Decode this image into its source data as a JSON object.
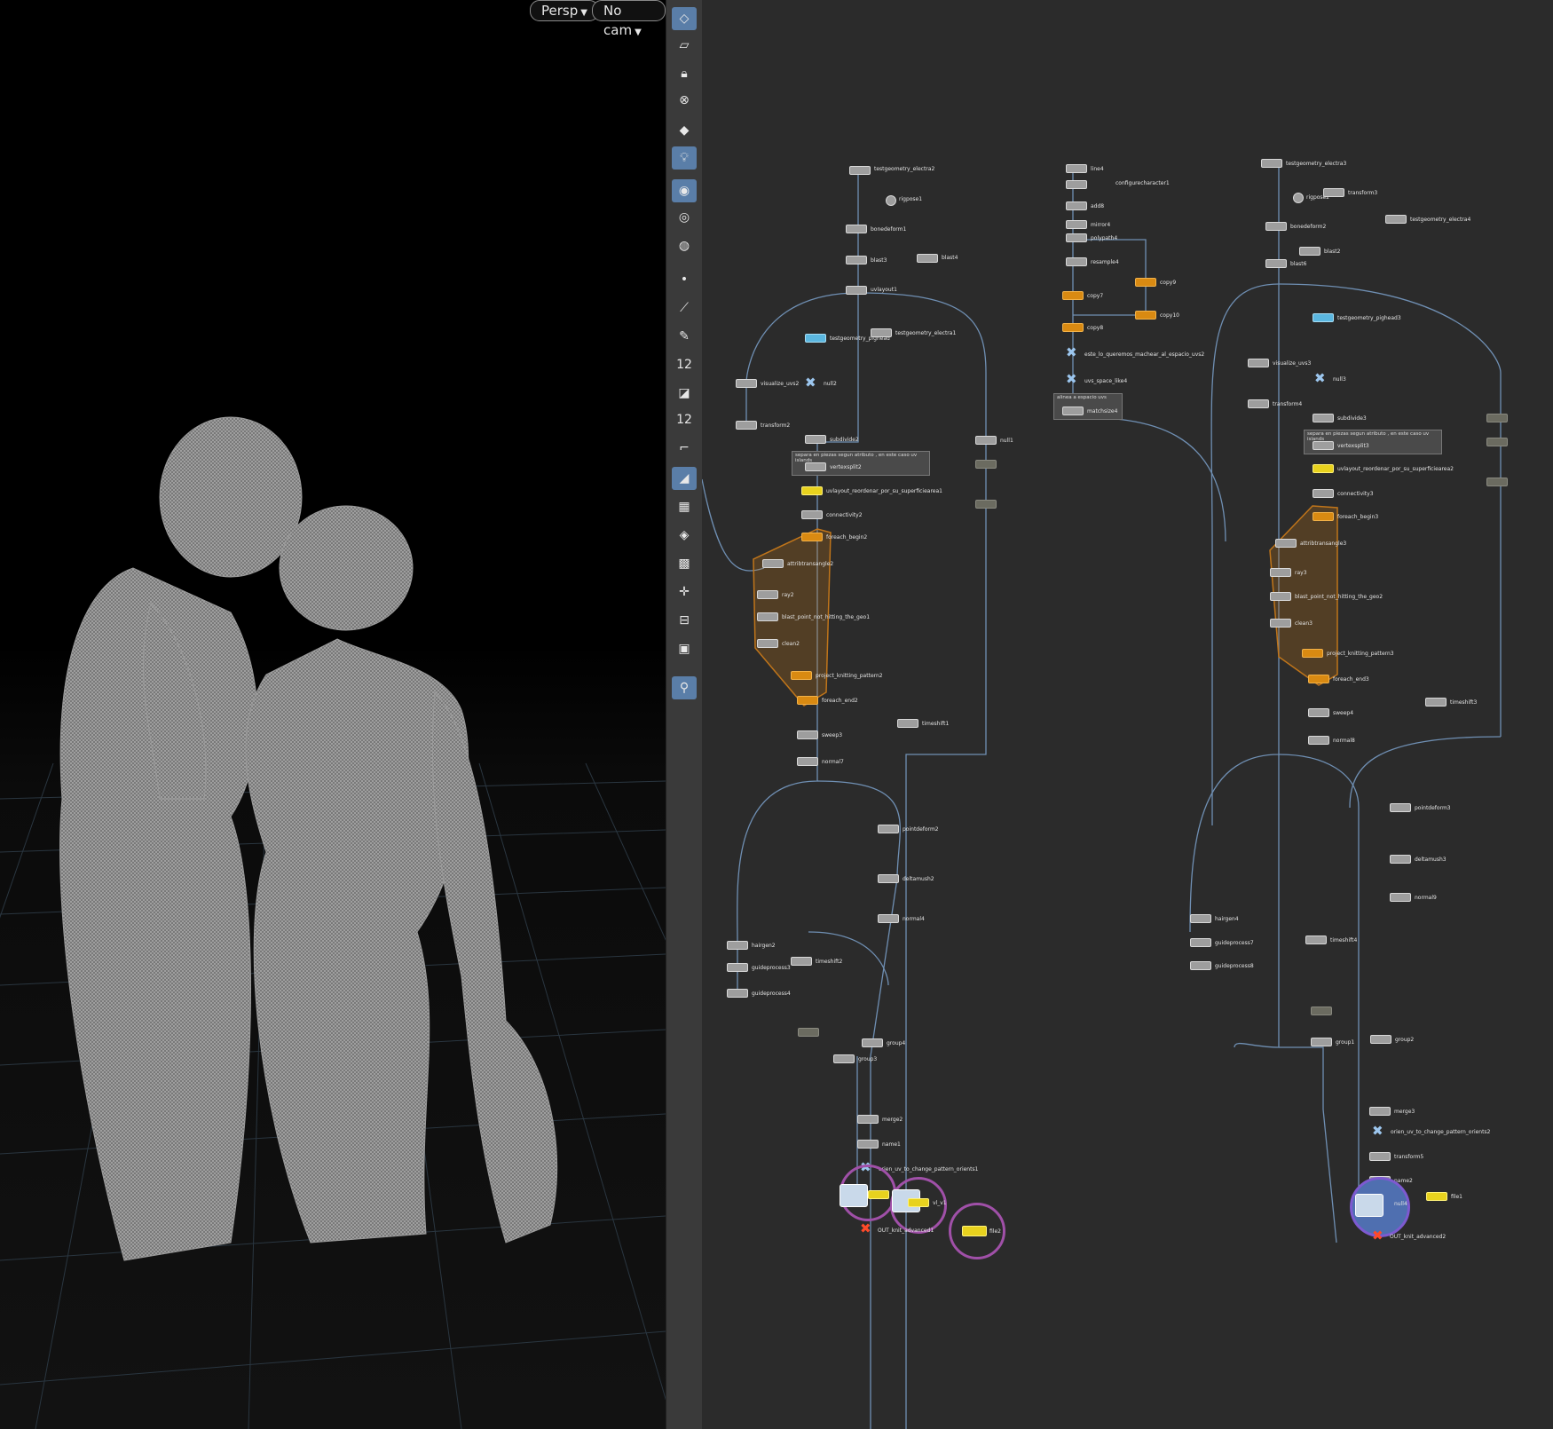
{
  "viewport": {
    "persp_label": "Persp",
    "cam_label": "No cam"
  },
  "toolbar": {
    "icons": [
      "select-icon",
      "edit-icon",
      "lock-icon",
      "ghost-icon",
      "light-diamond-icon",
      "bulb-icon",
      "display-mode-icon",
      "wire-eye-icon",
      "render-eye-icon",
      "point-icon",
      "brush-icon",
      "pen-icon",
      "point-count-icon",
      "surface-icon",
      "surface-count-icon",
      "curve-icon",
      "shaded-icon",
      "checker-icon",
      "frame-icon",
      "uv-icon",
      "axis-icon",
      "panel-icon",
      "landscape-icon",
      "pin-icon"
    ],
    "point_count": "12",
    "surface_count": "12"
  },
  "network": {
    "nodes": {
      "testgeometry_electra2": "testgeometry_electra2",
      "rigpose1": "rigpose1",
      "bonedeform1": "bonedeform1",
      "blast3": "blast3",
      "blast4": "blast4",
      "uvlayout1": "uvlayout1",
      "testgeometry_pighead": "testgeometry_pighead",
      "testgeometry_electra1": "testgeometry_electra1",
      "visualize_uvs2": "visualize_uvs2",
      "null2": "null2",
      "transform2": "transform2",
      "subdivide2": "subdivide2",
      "sticky1": "separa en piezas segun atributo , en este caso uv islands",
      "vertexsplit2": "vertexsplit2",
      "uvlayout_reordenar": "uvlayout_reordenar_por_su_superficiearea1",
      "connectivity2": "connectivity2",
      "foreach_begin2": "foreach_begin2",
      "attribtransangle2": "attribtransangle2",
      "ray2": "ray2",
      "blast_point2": "blast_point_not_hitting_the_geo1",
      "clean2": "clean2",
      "project_knitting_pattern2": "project_knitting_pattern2",
      "foreach_end2": "foreach_end2",
      "sweep3": "sweep3",
      "normal7": "normal7",
      "pointdeform2": "pointdeform2",
      "deltamush2": "deltamush2",
      "normal4": "normal4",
      "hairgen2": "hairgen2",
      "timeshift2": "timeshift2",
      "guideprocess3": "guideprocess3",
      "guideprocess4": "guideprocess4",
      "group4": "group4",
      "group3": "group3",
      "merge2": "merge2",
      "name1": "name1",
      "orien_uv1": "orien_uv_to_change_pattern_orients1",
      "vl": "vl",
      "vl_v1": "vl_v1",
      "out_knit1": "OUT_knit_advanced1",
      "file2": "file2",
      "timeshift1": "timeshift1",
      "null1": "null1",
      "line4": "line4",
      "configurecharacter1": "configurecharacter1",
      "add8": "add8",
      "mirror4": "mirror4",
      "polypath4": "polypath4",
      "resample4": "resample4",
      "copy7": "copy7",
      "copy9": "copy9",
      "copy8": "copy8",
      "copy10": "copy10",
      "este_lo": "este_lo_queremos_machear_al_espacio_uvs2",
      "uvs_space": "uvs_space_like4",
      "sticky2": "alinea a espacio uvs",
      "matchsize4": "matchsize4",
      "testgeometry_electra3": "testgeometry_electra3",
      "rigpose2": "rigpose2",
      "transform3": "transform3",
      "testgeometry_electra4": "testgeometry_electra4",
      "bonedeform2": "bonedeform2",
      "blast2": "blast2",
      "blast6": "blast6",
      "testgeometry_pighead3": "testgeometry_pighead3",
      "visualize_uvs3": "visualize_uvs3",
      "null3": "null3",
      "transform4": "transform4",
      "subdivide3": "subdivide3",
      "sticky3": "separa en piezas segun atributo , en este caso uv islands",
      "vertexsplit3": "vertexsplit3",
      "uvlayout_reordenar2": "uvlayout_reordenar_por_su_superficiearea2",
      "connectivity3": "connectivity3",
      "foreach_begin3": "foreach_begin3",
      "attribtransangle3": "attribtransangle3",
      "ray3": "ray3",
      "blast_point3": "blast_point_not_hitting_the_geo2",
      "clean3": "clean3",
      "project_knitting_pattern3": "project_knitting_pattern3",
      "foreach_end3": "foreach_end3",
      "sweep4": "sweep4",
      "normal8": "normal8",
      "timeshift3": "timeshift3",
      "pointdeform3": "pointdeform3",
      "deltamush3": "deltamush3",
      "normal9": "normal9",
      "hairgen4": "hairgen4",
      "guideprocess7": "guideprocess7",
      "guideprocess8": "guideprocess8",
      "timeshift4": "timeshift4",
      "group1": "group1",
      "group2": "group2",
      "merge3": "merge3",
      "orien_uv2": "orien_uv_to_change_pattern_orients2",
      "transform5": "transform5",
      "name2": "name2",
      "file1": "file1",
      "out_knit2": "OUT_knit_advanced2",
      "null4": "null4"
    }
  }
}
